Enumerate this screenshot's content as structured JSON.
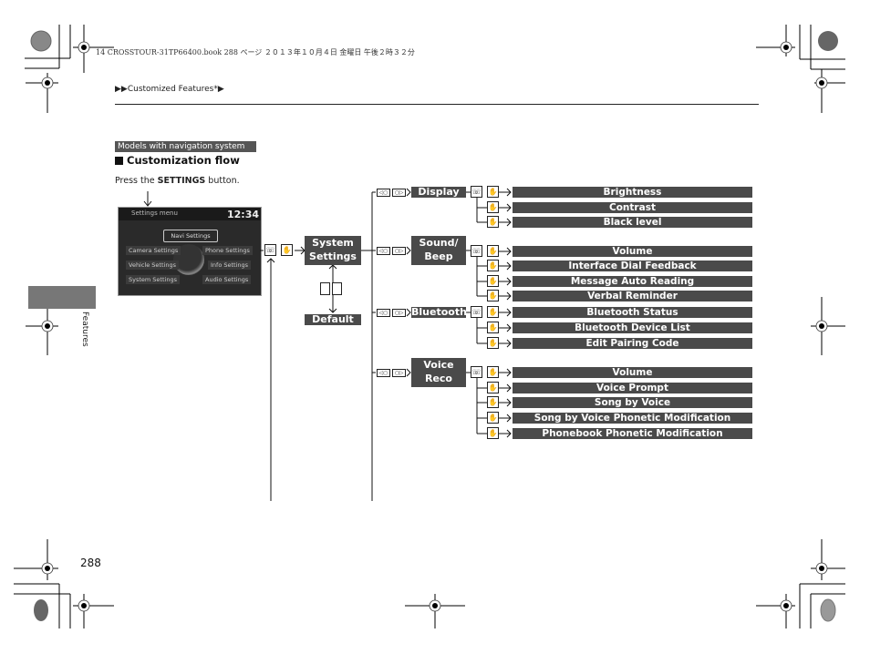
{
  "print_header": "14 CROSSTOUR-31TP66400.book  288 ページ  ２０１３年１０月４日  金曜日  午後２時３２分",
  "breadcrumb": {
    "prefix": "▶▶",
    "label": "Customized Features",
    "suffix": "*▶"
  },
  "model_tag": "Models with navigation system",
  "section_title": "Customization flow",
  "instruction": {
    "pre": "Press the ",
    "bold": "SETTINGS",
    "post": " button."
  },
  "side_tab_label": "Features",
  "page_number": "288",
  "screen": {
    "title": "Settings menu",
    "clock": "12:34",
    "buttons": [
      "Navi Settings",
      "Camera Settings",
      "Phone Settings",
      "Vehicle Settings",
      "Info Settings",
      "System Settings",
      "Audio Settings"
    ]
  },
  "flow": {
    "root": "System Settings",
    "root_lines": [
      "System",
      "Settings"
    ],
    "default": "Default",
    "categories": [
      {
        "name": "Display",
        "lines": [
          "Display"
        ],
        "items": [
          "Brightness",
          "Contrast",
          "Black level"
        ]
      },
      {
        "name": "Sound/Beep",
        "lines": [
          "Sound/",
          "Beep"
        ],
        "items": [
          "Volume",
          "Interface Dial Feedback",
          "Message Auto Reading",
          "Verbal Reminder"
        ]
      },
      {
        "name": "Bluetooth",
        "lines": [
          "Bluetooth"
        ],
        "items": [
          "Bluetooth Status",
          "Bluetooth Device List",
          "Edit Pairing Code"
        ]
      },
      {
        "name": "Voice Reco",
        "lines": [
          "Voice",
          "Reco"
        ],
        "items": [
          "Volume",
          "Voice Prompt",
          "Song by Voice",
          "Song by Voice Phonetic Modification",
          "Phonebook Phonetic Modification"
        ]
      }
    ]
  },
  "icons": {
    "press_knob": "☏",
    "select": "✋",
    "rotate": "⟲"
  }
}
